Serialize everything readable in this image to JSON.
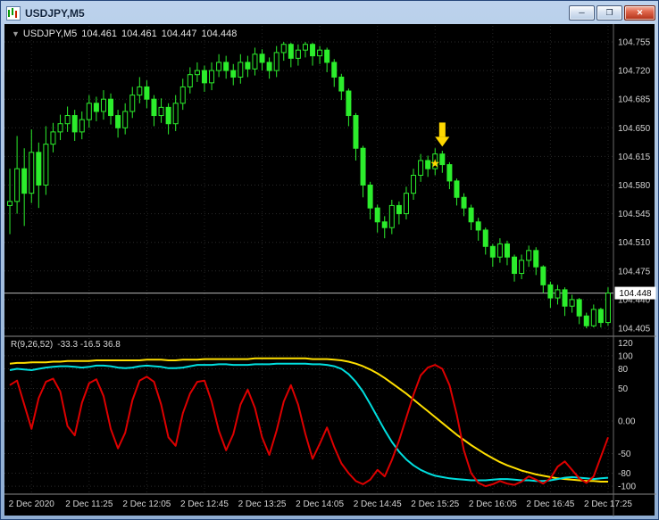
{
  "window": {
    "title": "USDJPY,M5",
    "controls": [
      {
        "name": "minimize",
        "glyph": "─"
      },
      {
        "name": "restore",
        "glyph": "❐"
      },
      {
        "name": "close",
        "glyph": "✕"
      }
    ]
  },
  "chart": {
    "header": {
      "collapse_glyph": "▼",
      "symbol": "USDJPY,M5",
      "open": "104.461",
      "high": "104.461",
      "low": "104.447",
      "close": "104.448"
    },
    "current_price": "104.448",
    "price_axis_labels": [
      "104.755",
      "104.720",
      "104.685",
      "104.650",
      "104.615",
      "104.580",
      "104.545",
      "104.510",
      "104.475",
      "104.440",
      "104.405"
    ],
    "time_axis": [
      {
        "bar": 3,
        "label": "2 Dec 2020"
      },
      {
        "bar": 11,
        "label": "2 Dec 11:25"
      },
      {
        "bar": 19,
        "label": "2 Dec 12:05"
      },
      {
        "bar": 27,
        "label": "2 Dec 12:45"
      },
      {
        "bar": 35,
        "label": "2 Dec 13:25"
      },
      {
        "bar": 43,
        "label": "2 Dec 14:05"
      },
      {
        "bar": 51,
        "label": "2 Dec 14:45"
      },
      {
        "bar": 59,
        "label": "2 Dec 15:25"
      },
      {
        "bar": 67,
        "label": "2 Dec 16:05"
      },
      {
        "bar": 75,
        "label": "2 Dec 16:45"
      },
      {
        "bar": 83,
        "label": "2 Dec 17:25"
      }
    ]
  },
  "indicator": {
    "name": "R(9,26,52)",
    "values": "-33.3 -16.5 36.8",
    "levels": [
      {
        "label": "120",
        "value": 120,
        "line": false
      },
      {
        "label": "100",
        "value": 100,
        "line": true
      },
      {
        "label": "80",
        "value": 80,
        "line": true
      },
      {
        "label": "50",
        "value": 50,
        "line": true
      },
      {
        "label": "0.00",
        "value": 0,
        "line": true
      },
      {
        "label": "-50",
        "value": -50,
        "line": true
      },
      {
        "label": "-80",
        "value": -80,
        "line": true
      },
      {
        "label": "-100",
        "value": -100,
        "line": true
      }
    ]
  },
  "annotations": {
    "arrow": {
      "bar": 60,
      "price": 104.627,
      "color": "#ffd800"
    },
    "star": {
      "bar": 59,
      "price": 104.606,
      "symbol": "★",
      "color": "#ffd800"
    }
  },
  "colors": {
    "candle": "#2ced2c",
    "bull_fill": "#000000",
    "grid": "#2a2a2a",
    "axis_text": "#d4d4d4",
    "bid_line": "#b8b8b8",
    "bid_tag_bg": "#ffffff",
    "bid_tag_text": "#000000",
    "separator": "#8a8a8a",
    "red_line": "#dd0000",
    "cyan_line": "#00dede",
    "yellow_line": "#ffdf00"
  },
  "chart_data": {
    "type": "candlestick",
    "symbol": "USDJPY",
    "timeframe": "M5",
    "price_range": [
      104.405,
      104.755
    ],
    "indicator_range": [
      -110,
      127
    ],
    "candles": [
      [
        104.555,
        104.6,
        104.52,
        104.56
      ],
      [
        104.56,
        104.64,
        104.545,
        104.6
      ],
      [
        104.6,
        104.625,
        104.53,
        104.57
      ],
      [
        104.57,
        104.648,
        104.558,
        104.62
      ],
      [
        104.62,
        104.632,
        104.552,
        104.58
      ],
      [
        104.58,
        104.652,
        104.568,
        104.63
      ],
      [
        104.63,
        104.656,
        104.62,
        104.645
      ],
      [
        104.645,
        104.666,
        104.635,
        104.655
      ],
      [
        104.655,
        104.676,
        104.645,
        104.665
      ],
      [
        104.665,
        104.672,
        104.634,
        104.645
      ],
      [
        104.645,
        104.67,
        104.636,
        104.66
      ],
      [
        104.66,
        104.69,
        104.65,
        104.68
      ],
      [
        104.68,
        104.688,
        104.658,
        104.67
      ],
      [
        104.67,
        104.696,
        104.66,
        104.685
      ],
      [
        104.685,
        104.692,
        104.654,
        104.665
      ],
      [
        104.665,
        104.672,
        104.638,
        104.65
      ],
      [
        104.65,
        104.68,
        104.642,
        104.67
      ],
      [
        104.67,
        104.7,
        104.662,
        104.69
      ],
      [
        104.69,
        104.712,
        104.68,
        104.7
      ],
      [
        104.7,
        104.708,
        104.674,
        104.685
      ],
      [
        104.685,
        104.69,
        104.652,
        104.665
      ],
      [
        104.665,
        104.686,
        104.656,
        104.675
      ],
      [
        104.675,
        104.68,
        104.642,
        104.655
      ],
      [
        104.655,
        104.69,
        104.646,
        104.68
      ],
      [
        104.68,
        104.71,
        104.672,
        104.7
      ],
      [
        104.7,
        104.724,
        104.692,
        104.715
      ],
      [
        104.715,
        104.73,
        104.706,
        104.72
      ],
      [
        104.72,
        104.726,
        104.694,
        104.705
      ],
      [
        104.705,
        104.73,
        104.696,
        104.72
      ],
      [
        104.72,
        104.74,
        104.712,
        104.73
      ],
      [
        104.73,
        104.738,
        104.71,
        104.72
      ],
      [
        104.72,
        104.728,
        104.702,
        104.712
      ],
      [
        104.712,
        104.74,
        104.704,
        104.73
      ],
      [
        104.73,
        104.738,
        104.712,
        104.722
      ],
      [
        104.722,
        104.748,
        104.714,
        104.74
      ],
      [
        104.74,
        104.746,
        104.72,
        104.73
      ],
      [
        104.73,
        104.736,
        104.71,
        104.72
      ],
      [
        104.72,
        104.75,
        104.712,
        104.742
      ],
      [
        104.742,
        104.755,
        104.732,
        104.752
      ],
      [
        104.752,
        104.754,
        104.724,
        104.735
      ],
      [
        104.735,
        104.752,
        104.726,
        104.745
      ],
      [
        104.745,
        104.755,
        104.736,
        104.752
      ],
      [
        104.752,
        104.754,
        104.726,
        104.738
      ],
      [
        104.738,
        104.75,
        104.728,
        104.745
      ],
      [
        104.745,
        104.748,
        104.718,
        104.73
      ],
      [
        104.73,
        104.734,
        104.7,
        104.712
      ],
      [
        104.712,
        104.716,
        104.684,
        104.695
      ],
      [
        104.695,
        104.698,
        104.652,
        104.665
      ],
      [
        104.665,
        104.668,
        104.61,
        104.625
      ],
      [
        104.625,
        104.628,
        104.565,
        104.58
      ],
      [
        104.58,
        104.584,
        104.538,
        104.552
      ],
      [
        104.552,
        104.556,
        104.522,
        104.535
      ],
      [
        104.535,
        104.542,
        104.515,
        104.528
      ],
      [
        104.528,
        104.562,
        104.52,
        104.555
      ],
      [
        104.555,
        104.56,
        104.532,
        104.545
      ],
      [
        104.545,
        104.578,
        104.538,
        104.57
      ],
      [
        104.57,
        104.6,
        104.562,
        104.592
      ],
      [
        104.592,
        104.618,
        104.584,
        104.61
      ],
      [
        104.61,
        104.616,
        104.59,
        104.6
      ],
      [
        104.6,
        104.625,
        104.592,
        104.618
      ],
      [
        104.618,
        104.622,
        104.595,
        104.605
      ],
      [
        104.605,
        104.608,
        104.575,
        104.585
      ],
      [
        104.585,
        104.588,
        104.555,
        104.565
      ],
      [
        104.565,
        104.57,
        104.542,
        104.552
      ],
      [
        104.552,
        104.556,
        104.525,
        104.535
      ],
      [
        104.535,
        104.54,
        104.512,
        104.525
      ],
      [
        104.525,
        104.528,
        104.495,
        104.505
      ],
      [
        104.505,
        104.508,
        104.48,
        104.492
      ],
      [
        104.492,
        104.515,
        104.485,
        104.508
      ],
      [
        104.508,
        104.512,
        104.482,
        104.492
      ],
      [
        104.492,
        104.495,
        104.462,
        104.472
      ],
      [
        104.472,
        104.495,
        104.465,
        104.488
      ],
      [
        104.488,
        104.506,
        104.48,
        104.5
      ],
      [
        104.5,
        104.504,
        104.47,
        104.48
      ],
      [
        104.48,
        104.482,
        104.448,
        104.458
      ],
      [
        104.458,
        104.462,
        104.43,
        104.442
      ],
      [
        104.442,
        104.458,
        104.434,
        104.452
      ],
      [
        104.452,
        104.455,
        104.42,
        104.432
      ],
      [
        104.432,
        104.446,
        104.424,
        104.44
      ],
      [
        104.44,
        104.442,
        104.41,
        104.42
      ],
      [
        104.42,
        104.424,
        104.405,
        104.408
      ],
      [
        104.408,
        104.434,
        104.406,
        104.428
      ],
      [
        104.428,
        104.43,
        104.406,
        104.412
      ],
      [
        104.412,
        104.455,
        104.408,
        104.448
      ]
    ],
    "oscillator_series": [
      {
        "name": "fast",
        "color": "#dd0000",
        "values": [
          55,
          62,
          25,
          -12,
          35,
          60,
          65,
          45,
          -8,
          -22,
          28,
          58,
          64,
          38,
          -12,
          -42,
          -18,
          32,
          62,
          68,
          60,
          25,
          -25,
          -38,
          12,
          42,
          60,
          62,
          30,
          -15,
          -45,
          -20,
          25,
          48,
          20,
          -25,
          -52,
          -15,
          30,
          55,
          25,
          -20,
          -58,
          -35,
          -10,
          -40,
          -65,
          -80,
          -92,
          -97,
          -90,
          -75,
          -85,
          -60,
          -30,
          5,
          40,
          70,
          82,
          86,
          80,
          55,
          10,
          -45,
          -80,
          -95,
          -100,
          -97,
          -92,
          -96,
          -98,
          -93,
          -85,
          -90,
          -96,
          -88,
          -70,
          -62,
          -75,
          -88,
          -95,
          -85,
          -55,
          -25
        ]
      },
      {
        "name": "medium",
        "color": "#00dede",
        "values": [
          78,
          80,
          79,
          78,
          80,
          82,
          83,
          84,
          84,
          83,
          82,
          83,
          85,
          85,
          84,
          82,
          81,
          82,
          84,
          85,
          84,
          83,
          81,
          81,
          82,
          84,
          86,
          86,
          86,
          87,
          87,
          86,
          86,
          86,
          87,
          87,
          87,
          88,
          88,
          88,
          88,
          88,
          87,
          87,
          86,
          84,
          80,
          72,
          60,
          45,
          26,
          6,
          -14,
          -32,
          -47,
          -59,
          -68,
          -75,
          -80,
          -84,
          -86,
          -88,
          -89,
          -90,
          -91,
          -91,
          -91,
          -90,
          -89,
          -89,
          -90,
          -91,
          -91,
          -92,
          -92,
          -91,
          -89,
          -87,
          -86,
          -87,
          -88,
          -89,
          -88,
          -87
        ]
      },
      {
        "name": "slow",
        "color": "#ffdf00",
        "values": [
          88,
          89,
          89,
          90,
          90,
          90,
          91,
          91,
          92,
          92,
          92,
          92,
          93,
          93,
          93,
          93,
          93,
          93,
          93,
          94,
          94,
          94,
          93,
          93,
          94,
          94,
          94,
          95,
          95,
          95,
          95,
          95,
          95,
          95,
          96,
          96,
          96,
          96,
          96,
          96,
          96,
          96,
          95,
          95,
          95,
          94,
          93,
          91,
          88,
          84,
          79,
          73,
          66,
          58,
          50,
          42,
          33,
          24,
          15,
          6,
          -3,
          -12,
          -21,
          -29,
          -37,
          -44,
          -51,
          -57,
          -63,
          -68,
          -72,
          -76,
          -79,
          -82,
          -84,
          -86,
          -88,
          -89,
          -90,
          -91,
          -92,
          -92,
          -93,
          -93
        ]
      }
    ]
  }
}
